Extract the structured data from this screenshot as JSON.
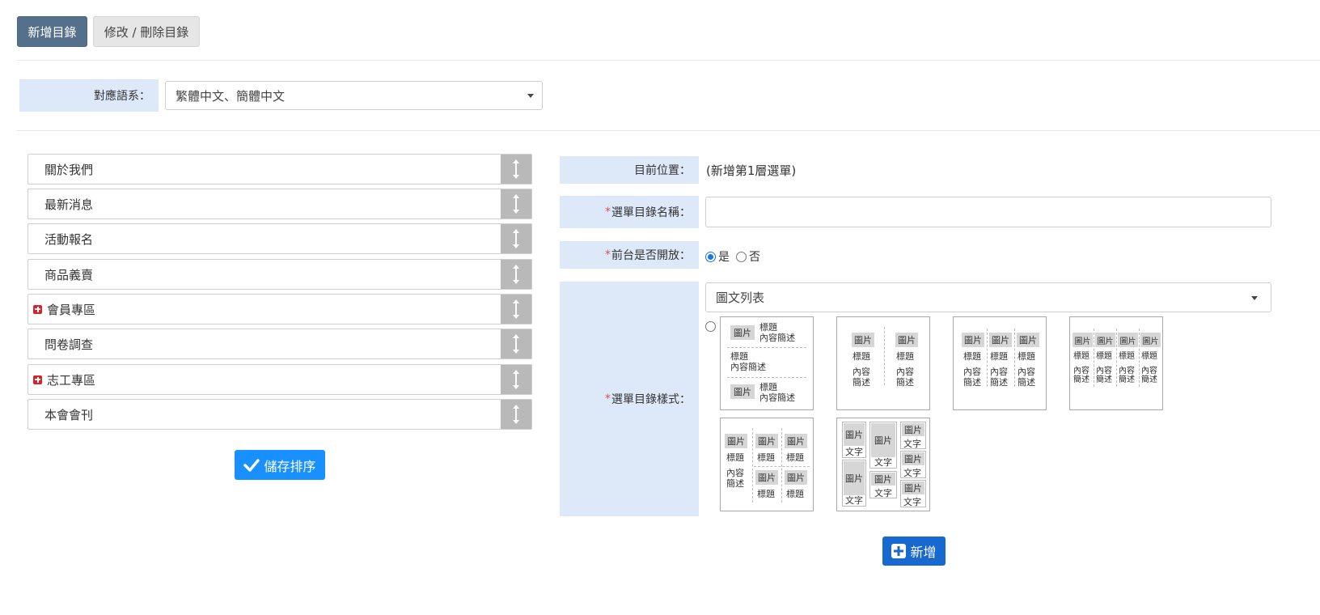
{
  "tabs": {
    "add": "新增目錄",
    "edit": "修改 / 刪除目錄"
  },
  "language": {
    "label": "對應語系：",
    "value": "繁體中文、簡體中文"
  },
  "menu_items": [
    {
      "label": "關於我們",
      "expandable": false
    },
    {
      "label": "最新消息",
      "expandable": false
    },
    {
      "label": "活動報名",
      "expandable": false
    },
    {
      "label": "商品義賣",
      "expandable": false
    },
    {
      "label": "會員專區",
      "expandable": true
    },
    {
      "label": "問卷調查",
      "expandable": false
    },
    {
      "label": "志工專區",
      "expandable": true
    },
    {
      "label": "本會會刊",
      "expandable": false
    }
  ],
  "save_order_label": "儲存排序",
  "form": {
    "position_label": "目前位置：",
    "position_value": "(新增第1層選單)",
    "required_mark": "*",
    "name_label": "選單目錄名稱：",
    "name_value": "",
    "open_label": "前台是否開放：",
    "open_yes": "是",
    "open_no": "否",
    "style_label": "選單目錄樣式：",
    "style_value": "圖文列表",
    "submit_label": "新增"
  },
  "thumb_text": {
    "pic": "圖片",
    "title": "標題",
    "desc": "內容簡述",
    "desc_a": "內容",
    "desc_b": "簡述",
    "word": "文字"
  }
}
